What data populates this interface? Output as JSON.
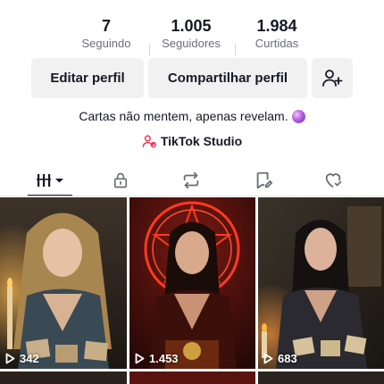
{
  "profile": {
    "stats": [
      {
        "value": "7",
        "label": "Seguindo"
      },
      {
        "value": "1.005",
        "label": "Seguidores"
      },
      {
        "value": "1.984",
        "label": "Curtidas"
      }
    ],
    "buttons": {
      "edit_label": "Editar perfil",
      "share_label": "Compartilhar perfil"
    },
    "bio": "Cartas não mentem, apenas revelam.",
    "studio_label": "TikTok Studio"
  },
  "tabs": [
    {
      "name": "videos",
      "icon": "grid-bars-icon",
      "active": true
    },
    {
      "name": "private",
      "icon": "lock-icon"
    },
    {
      "name": "reposts",
      "icon": "repost-icon"
    },
    {
      "name": "favorites",
      "icon": "bookmark-icon"
    },
    {
      "name": "liked",
      "icon": "heart-icon"
    }
  ],
  "videos": [
    {
      "views": "342"
    },
    {
      "views": "1.453"
    },
    {
      "views": "683"
    }
  ],
  "colors": {
    "text": "#161823",
    "secondary_text": "#6b6e75",
    "button_bg": "#f1f1f2",
    "studio_icon": "#fe2c55"
  }
}
